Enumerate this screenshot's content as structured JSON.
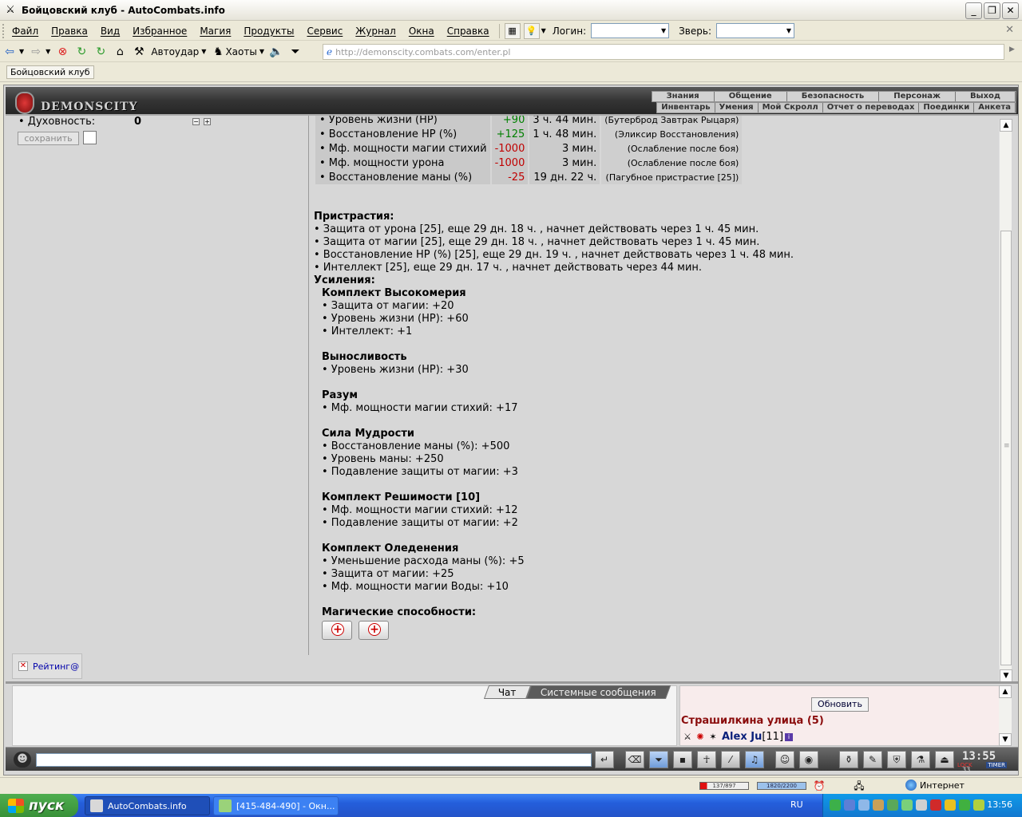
{
  "window": {
    "title": "Бойцовский клуб - AutoCombats.info",
    "controls": {
      "min": "_",
      "max": "❐",
      "close": "✕"
    }
  },
  "menubar": {
    "items": [
      "Файл",
      "Правка",
      "Вид",
      "Избранное",
      "Магия",
      "Продукты",
      "Сервис",
      "Журнал",
      "Окна",
      "Справка"
    ],
    "login_label": "Логин:",
    "beast_label": "Зверь:"
  },
  "toolbar": {
    "autoudar": "Автоудар",
    "chaoty": "Хаоты",
    "url": "http://demonscity.combats.com/enter.pl"
  },
  "linksbar": {
    "link": "Бойцовский клуб"
  },
  "game_header": {
    "logo_text": "DEMONSCITY",
    "nav_top": [
      "Знания",
      "Общение",
      "Безопасность",
      "Персонаж",
      "Выход"
    ],
    "nav_bottom": [
      "Инвентарь",
      "Умения",
      "Мой Скролл",
      "Отчет о переводах",
      "Поединки",
      "Анкета"
    ]
  },
  "left_panel": {
    "stat_label": "• Духовность:",
    "stat_value": "0",
    "minus": "−",
    "plus": "+",
    "save_label": "сохранить",
    "rating": "Рейтинг@"
  },
  "effects": [
    {
      "name": "• Уровень жизни (HP)",
      "value": "+90",
      "sign": "pos",
      "time": "3 ч. 44 мин.",
      "source": "(Бутерброд Завтрак Рыцаря)"
    },
    {
      "name": "• Восстановление HP (%)",
      "value": "+125",
      "sign": "pos",
      "time": "1 ч. 48 мин.",
      "source": "(Эликсир Восстановления)"
    },
    {
      "name": "• Мф. мощности магии стихий",
      "value": "-1000",
      "sign": "neg",
      "time": "3 мин.",
      "source": "(Ослабление после боя)"
    },
    {
      "name": "• Мф. мощности урона",
      "value": "-1000",
      "sign": "neg",
      "time": "3 мин.",
      "source": "(Ослабление после боя)"
    },
    {
      "name": "• Восстановление маны (%)",
      "value": "-25",
      "sign": "neg",
      "time": "19 дн. 22 ч.",
      "source": "(Пагубное пристрастие [25])"
    }
  ],
  "addictions": {
    "title": "Пристрастия:",
    "items": [
      "• Защита от урона [25], еще 29 дн. 18 ч. , начнет действовать через 1 ч. 45 мин.",
      "• Защита от магии [25], еще 29 дн. 18 ч. , начнет действовать через 1 ч. 45 мин.",
      "• Восстановление HP (%) [25], еще 29 дн. 19 ч. , начнет действовать через 1 ч. 48 мин.",
      "• Интеллект [25], еще 29 дн. 17 ч. , начнет действовать через 44 мин."
    ]
  },
  "boosts": {
    "title": "Усиления:",
    "groups": [
      {
        "name": "Комплект Высокомерия",
        "items": [
          "• Защита от магии: +20",
          "• Уровень жизни (HP): +60",
          "• Интеллект: +1"
        ]
      },
      {
        "name": "Выносливость",
        "items": [
          "• Уровень жизни (HP): +30"
        ]
      },
      {
        "name": "Разум",
        "items": [
          "• Мф. мощности магии стихий: +17"
        ]
      },
      {
        "name": "Сила Мудрости",
        "items": [
          "• Восстановление маны (%): +500",
          "• Уровень маны: +250",
          "• Подавление защиты от магии: +3"
        ]
      },
      {
        "name": "Комплект Решимости [10]",
        "items": [
          "• Мф. мощности магии стихий: +12",
          "• Подавление защиты от магии: +2"
        ]
      },
      {
        "name": "Комплект Оледенения",
        "items": [
          "• Уменьшение расхода маны (%): +5",
          "• Защита от магии: +25",
          "• Мф. мощности магии Воды: +10"
        ]
      }
    ],
    "magic_title": "Магические способности:"
  },
  "chat": {
    "tab_chat": "Чат",
    "tab_system": "Системные сообщения",
    "refresh": "Обновить",
    "room": "Страшилкина улица (5)",
    "user_nick": "Alex Ju",
    "user_level": "[11]"
  },
  "clock": {
    "time": "13:55",
    "seconds": "33",
    "lock": "LOCK",
    "timer": "TIMER"
  },
  "statusbar": {
    "hp": "137/897",
    "mana": "1820/2200",
    "zone": "Интернет"
  },
  "taskbar": {
    "start": "пуск",
    "task1": "AutoCombats.info",
    "task2": "[415-484-490] - Окн...",
    "lang": "RU",
    "time": "13:56"
  }
}
